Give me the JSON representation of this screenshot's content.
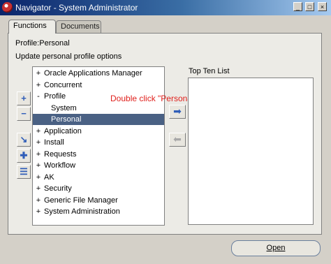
{
  "window": {
    "title": "Navigator - System Administrator",
    "buttons": {
      "minimize": "_",
      "maximize": "□",
      "close": "×"
    }
  },
  "tabs": [
    {
      "label": "Functions",
      "active": true
    },
    {
      "label": "Documents",
      "active": false
    }
  ],
  "profile_label": "Profile:Personal",
  "update_label": "Update personal profile options",
  "tree": [
    {
      "sign": "+",
      "label": "Oracle Applications Manager",
      "level": 0
    },
    {
      "sign": "+",
      "label": "Concurrent",
      "level": 0
    },
    {
      "sign": "-",
      "label": "Profile",
      "level": 0
    },
    {
      "sign": "",
      "label": "System",
      "level": 1
    },
    {
      "sign": "",
      "label": "Personal",
      "level": 1,
      "selected": true
    },
    {
      "sign": "+",
      "label": "Application",
      "level": 0
    },
    {
      "sign": "+",
      "label": "Install",
      "level": 0
    },
    {
      "sign": "+",
      "label": "Requests",
      "level": 0
    },
    {
      "sign": "+",
      "label": "Workflow",
      "level": 0
    },
    {
      "sign": "+",
      "label": "AK",
      "level": 0
    },
    {
      "sign": "+",
      "label": "Security",
      "level": 0
    },
    {
      "sign": "+",
      "label": "Generic File Manager",
      "level": 0
    },
    {
      "sign": "+",
      "label": "System Administration",
      "level": 0
    }
  ],
  "top_ten_label": "Top Ten List",
  "annotation": "Double click \"Personal\"|",
  "open_button": "Open",
  "side_buttons": [
    {
      "name": "expand-button",
      "glyph": "+"
    },
    {
      "name": "collapse-button",
      "glyph": "−"
    },
    {
      "name": "expand-branch-button",
      "glyph": "↘"
    },
    {
      "name": "expand-all-button",
      "glyph": "✚"
    },
    {
      "name": "collapse-all-button",
      "glyph": "☰"
    }
  ],
  "arrow_buttons": {
    "add": "➡",
    "remove": "⬅"
  },
  "colors": {
    "selection": "#4a6184",
    "annotation": "#e0201c",
    "titlebar": "#0a246a"
  }
}
